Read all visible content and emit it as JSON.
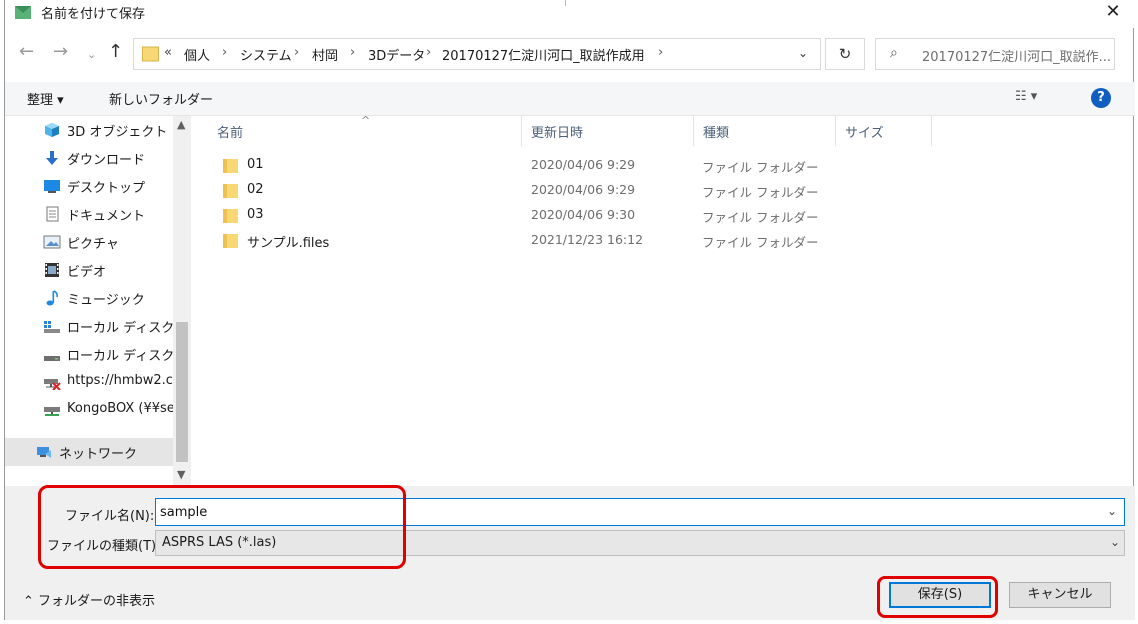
{
  "window": {
    "title": "名前を付けて保存",
    "close_glyph": "✕"
  },
  "address": {
    "recent_glyph": "«",
    "breadcrumbs": [
      "個人",
      "システム",
      "村岡",
      "3Dデータ",
      "20170127仁淀川河口_取説作成用"
    ],
    "separator": "›",
    "search_placeholder": "20170127仁淀川河口_取説作..."
  },
  "toolbar": {
    "organize_label": "整理 ▾",
    "new_folder_label": "新しいフォルダー",
    "view_label": "☷ ▾",
    "help_label": "?"
  },
  "nav_pane": {
    "items": [
      {
        "label": "3D オブジェクト",
        "icon": "cube-icon"
      },
      {
        "label": "ダウンロード",
        "icon": "download-icon"
      },
      {
        "label": "デスクトップ",
        "icon": "desktop-icon"
      },
      {
        "label": "ドキュメント",
        "icon": "document-icon"
      },
      {
        "label": "ピクチャ",
        "icon": "picture-icon"
      },
      {
        "label": "ビデオ",
        "icon": "video-icon"
      },
      {
        "label": "ミュージック",
        "icon": "music-icon"
      },
      {
        "label": "ローカル ディスク (C",
        "icon": "drive-icon"
      },
      {
        "label": "ローカル ディスク (D",
        "icon": "drive-icon"
      },
      {
        "label": "https://hmbw2.c",
        "icon": "network-drive-disconnected-icon"
      },
      {
        "label": "KongoBOX (¥¥se",
        "icon": "network-drive-icon"
      },
      {
        "label": "ネットワーク",
        "icon": "network-icon"
      }
    ]
  },
  "file_list": {
    "columns": [
      "名前",
      "更新日時",
      "種類",
      "サイズ"
    ],
    "rows": [
      {
        "name": "01",
        "date": "2020/04/06 9:29",
        "type": "ファイル フォルダー"
      },
      {
        "name": "02",
        "date": "2020/04/06 9:29",
        "type": "ファイル フォルダー"
      },
      {
        "name": "03",
        "date": "2020/04/06 9:30",
        "type": "ファイル フォルダー"
      },
      {
        "name": "サンプル.files",
        "date": "2021/12/23 16:12",
        "type": "ファイル フォルダー"
      }
    ]
  },
  "form": {
    "filename_label": "ファイル名(N):",
    "filename_value": "sample",
    "filetype_label": "ファイルの種類(T):",
    "filetype_value": "ASPRS LAS (*.las)"
  },
  "footer": {
    "hide_folders_label": "フォルダーの非表示",
    "save_label": "保存(S)",
    "cancel_label": "キャンセル"
  },
  "colors": {
    "accent": "#0078d7",
    "highlight": "#e00000",
    "folder": "#f8d775"
  }
}
